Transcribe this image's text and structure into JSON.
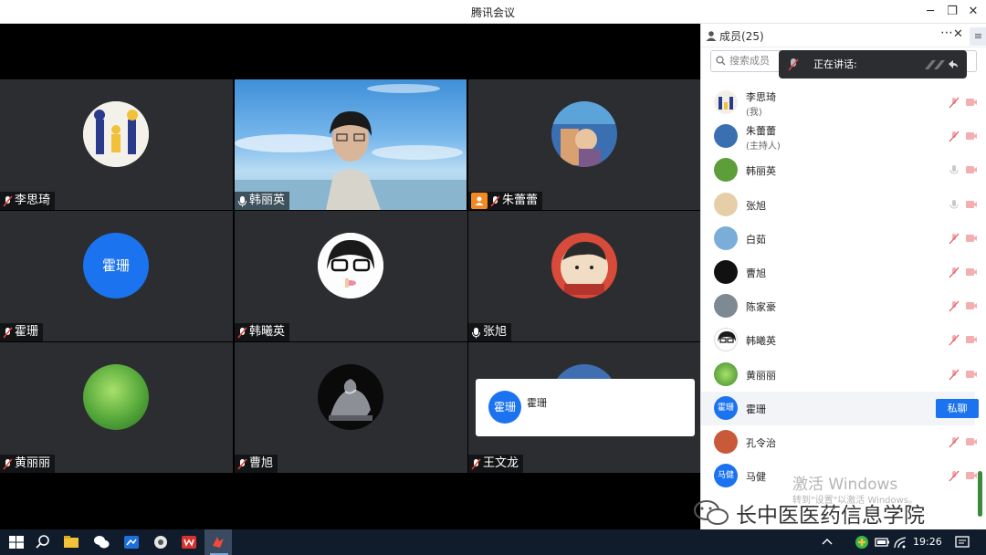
{
  "window": {
    "title": "腾讯会议"
  },
  "panel": {
    "title": "成员(25)",
    "search_placeholder": "搜索成员",
    "speaking_label": "正在讲话:",
    "chat_button": "私聊"
  },
  "tiles": [
    {
      "name": "李思琦"
    },
    {
      "name": "韩丽英"
    },
    {
      "name": "朱蕾蕾"
    },
    {
      "name": "霍珊",
      "avatar_text": "霍珊"
    },
    {
      "name": "韩曦英"
    },
    {
      "name": "张旭"
    },
    {
      "name": "黄丽丽"
    },
    {
      "name": "曹旭"
    },
    {
      "name": "王文龙"
    }
  ],
  "popup": {
    "avatar_text": "霍珊",
    "name": "霍珊"
  },
  "members": [
    {
      "name": "李思琦",
      "role": "(我)"
    },
    {
      "name": "朱蕾蕾",
      "role": "(主持人)"
    },
    {
      "name": "韩丽英"
    },
    {
      "name": "张旭"
    },
    {
      "name": "白茹"
    },
    {
      "name": "曹旭"
    },
    {
      "name": "陈家豪"
    },
    {
      "name": "韩曦英"
    },
    {
      "name": "黄丽丽"
    },
    {
      "name": "霍珊",
      "avatar_text": "霍珊"
    },
    {
      "name": "孔令治"
    },
    {
      "name": "马健",
      "avatar_text": "马健"
    }
  ],
  "watermark": {
    "activate": "激活 Windows",
    "activate_sub": "转到\"设置\"以激活 Windows。",
    "brand": "长中医医药信息学院"
  },
  "taskbar": {
    "time": "19:26"
  },
  "colors": {
    "accent": "#1b73f0",
    "tile_bg": "#2b2d31",
    "host_badge": "#f08a24",
    "taskbar": "#101c2c"
  }
}
